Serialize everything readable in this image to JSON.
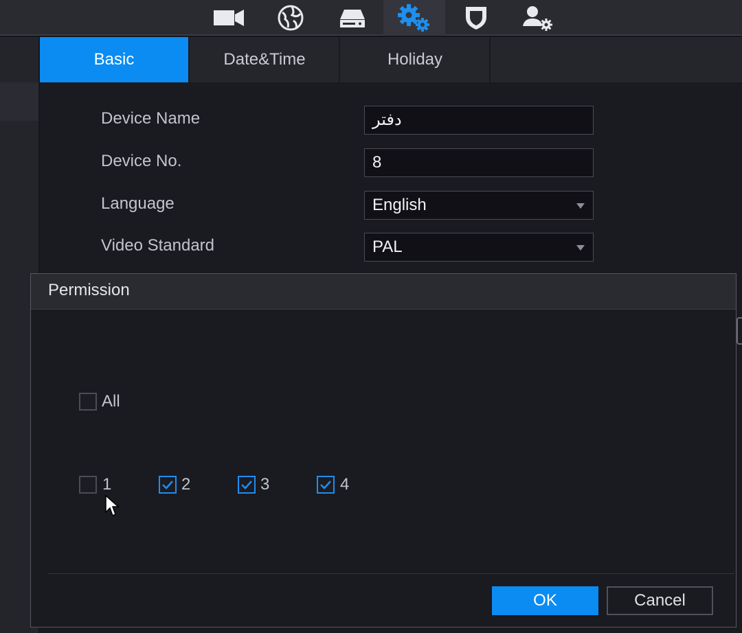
{
  "toolbar": {
    "icons": [
      "camera-icon",
      "network-globe-icon",
      "storage-icon",
      "system-settings-icon",
      "security-shield-icon",
      "account-settings-icon"
    ],
    "active_icon": "system-settings-icon",
    "accent": "#0a8cf2"
  },
  "tabs": [
    {
      "label": "Basic",
      "active": true
    },
    {
      "label": "Date&Time",
      "active": false
    },
    {
      "label": "Holiday",
      "active": false
    }
  ],
  "form": {
    "device_name": {
      "label": "Device Name",
      "value": "دفتر"
    },
    "device_no": {
      "label": "Device No.",
      "value": "8"
    },
    "language": {
      "label": "Language",
      "value": "English"
    },
    "video_standard": {
      "label": "Video Standard",
      "value": "PAL"
    }
  },
  "modal": {
    "title": "Permission",
    "all": {
      "label": "All",
      "checked": false
    },
    "channels": [
      {
        "label": "1",
        "checked": false
      },
      {
        "label": "2",
        "checked": true
      },
      {
        "label": "3",
        "checked": true
      },
      {
        "label": "4",
        "checked": true
      }
    ],
    "ok_label": "OK",
    "cancel_label": "Cancel"
  }
}
